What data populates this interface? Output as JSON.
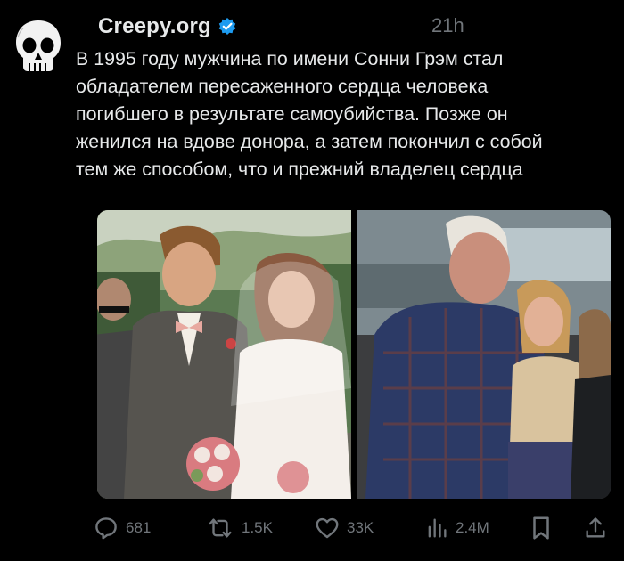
{
  "post": {
    "author": {
      "name": "Creepy.org",
      "verified": true,
      "avatar_icon": "skull-icon"
    },
    "time": "21h",
    "text": "В 1995 году мужчина по имени Сонни Грэм стал\nобладателем пересаженного сердца человека\nпогибшего в результате самоубийства. Позже он\nженился на вдове донора, а затем покончил с собой\nтем же способом, что и прежний владелец сердца",
    "media": [
      {
        "description": "wedding-photo",
        "side": "left"
      },
      {
        "description": "older-man-with-woman-photo",
        "side": "right"
      }
    ],
    "actions": {
      "replies": "681",
      "reposts": "1.5K",
      "likes": "33K",
      "views": "2.4M"
    }
  },
  "colors": {
    "background": "#000000",
    "text": "#e7e9ea",
    "muted": "#71767b",
    "verified": "#1d9bf0"
  }
}
